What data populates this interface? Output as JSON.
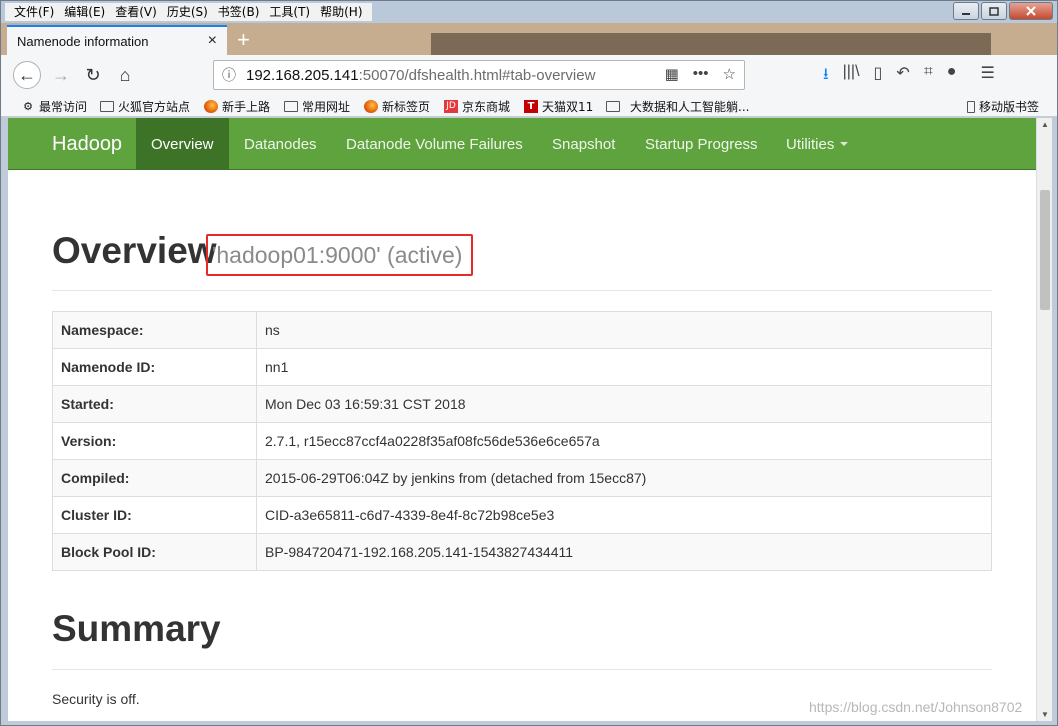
{
  "menubar": {
    "items": [
      "文件(F)",
      "编辑(E)",
      "查看(V)",
      "历史(S)",
      "书签(B)",
      "工具(T)",
      "帮助(H)"
    ]
  },
  "tab": {
    "title": "Namenode information",
    "close_icon": "×",
    "new_tab_icon": "+"
  },
  "nav": {
    "url_host": "192.168.205.141",
    "url_rest": ":50070/dfshealth.html#tab-overview",
    "back_icon": "←",
    "forward_icon": "→",
    "reload_icon": "↻",
    "home_icon": "⌂",
    "info_icon": "ⓘ",
    "qr_icon": "▦",
    "more_icon": "•••",
    "star_icon": "☆",
    "download_icon": "⭳",
    "library_icon": "|||\\",
    "sidebar_icon": "▯",
    "undo_icon": "↶",
    "crop_icon": "⌗",
    "chat_icon": "●",
    "menu_icon": "☰"
  },
  "bookmarks": {
    "items": [
      {
        "label": "最常访问",
        "icon": "gear-icon"
      },
      {
        "label": "火狐官方站点",
        "icon": "folder-icon"
      },
      {
        "label": "新手上路",
        "icon": "firefox-icon"
      },
      {
        "label": "常用网址",
        "icon": "folder-icon"
      },
      {
        "label": "新标签页",
        "icon": "firefox-icon"
      },
      {
        "label": "京东商城",
        "icon": "jd-icon"
      },
      {
        "label": "天猫双11",
        "icon": "tmall-icon"
      },
      {
        "label": "大数据和人工智能躺...",
        "icon": "folder-icon"
      }
    ],
    "mobile": "移动版书签",
    "jd_glyph": "JD",
    "tmall_glyph": "T"
  },
  "hadoop_nav": {
    "brand": "Hadoop",
    "items": [
      "Overview",
      "Datanodes",
      "Datanode Volume Failures",
      "Snapshot",
      "Startup Progress",
      "Utilities"
    ],
    "active": "Overview",
    "color": "#5fa33e"
  },
  "overview": {
    "title": "Overview",
    "host": "'hadoop01:9000' (active)",
    "rows": [
      {
        "key": "Namespace:",
        "value": "ns"
      },
      {
        "key": "Namenode ID:",
        "value": "nn1"
      },
      {
        "key": "Started:",
        "value": "Mon Dec 03 16:59:31 CST 2018"
      },
      {
        "key": "Version:",
        "value": "2.7.1, r15ecc87ccf4a0228f35af08fc56de536e6ce657a"
      },
      {
        "key": "Compiled:",
        "value": "2015-06-29T06:04Z by jenkins from (detached from 15ecc87)"
      },
      {
        "key": "Cluster ID:",
        "value": "CID-a3e65811-c6d7-4339-8e4f-8c72b98ce5e3"
      },
      {
        "key": "Block Pool ID:",
        "value": "BP-984720471-192.168.205.141-1543827434411"
      }
    ]
  },
  "summary": {
    "title": "Summary",
    "security": "Security is off."
  },
  "watermark": "https://blog.csdn.net/Johnson8702"
}
